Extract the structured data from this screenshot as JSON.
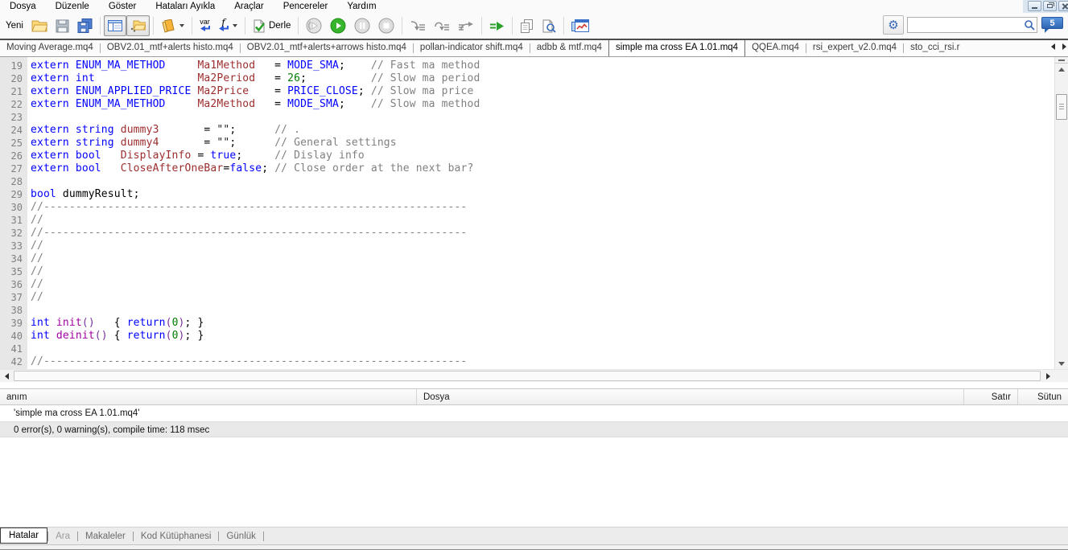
{
  "menu": {
    "items": [
      "Dosya",
      "Düzenle",
      "Göster",
      "Hataları Ayıkla",
      "Araçlar",
      "Pencereler",
      "Yardım"
    ]
  },
  "toolbar": {
    "new_label": "Yeni",
    "compile_label": "Derle",
    "var_label": "var",
    "fn_label": "f",
    "search_value": "",
    "community_label": "5"
  },
  "tabs": {
    "items": [
      {
        "label": "Moving Average.mq4",
        "active": false
      },
      {
        "label": "OBV2.01_mtf+alerts histo.mq4",
        "active": false
      },
      {
        "label": "OBV2.01_mtf+alerts+arrows histo.mq4",
        "active": false
      },
      {
        "label": "pollan-indicator shift.mq4",
        "active": false
      },
      {
        "label": "adbb & mtf.mq4",
        "active": false
      },
      {
        "label": "simple ma cross EA 1.01.mq4",
        "active": true
      },
      {
        "label": "QQEA.mq4",
        "active": false
      },
      {
        "label": "rsi_expert_v2.0.mq4",
        "active": false
      },
      {
        "label": "sto_cci_rsi.r",
        "active": false
      }
    ]
  },
  "syntax_colors": {
    "keyword": "#0000ff",
    "identifier": "#9c2d2d",
    "number": "#007d00",
    "comment": "#808080",
    "plain": "#000000",
    "function": "#a100a1",
    "bracket": "#7d30a0",
    "string": "#202020"
  },
  "editor": {
    "lines": [
      {
        "n": 19,
        "t": [
          [
            "k",
            "extern"
          ],
          [
            "p",
            " "
          ],
          [
            "k",
            "ENUM_MA_METHOD"
          ],
          [
            "p",
            "     "
          ],
          [
            "i",
            "Ma1Method"
          ],
          [
            "p",
            "   = "
          ],
          [
            "k",
            "MODE_SMA"
          ],
          [
            "p",
            ";    "
          ],
          [
            "c",
            "// Fast ma method"
          ]
        ]
      },
      {
        "n": 20,
        "t": [
          [
            "k",
            "extern"
          ],
          [
            "p",
            " "
          ],
          [
            "k",
            "int"
          ],
          [
            "p",
            "                "
          ],
          [
            "i",
            "Ma2Period"
          ],
          [
            "p",
            "   = "
          ],
          [
            "n",
            "26"
          ],
          [
            "p",
            ";          "
          ],
          [
            "c",
            "// Slow ma period"
          ]
        ]
      },
      {
        "n": 21,
        "t": [
          [
            "k",
            "extern"
          ],
          [
            "p",
            " "
          ],
          [
            "k",
            "ENUM_APPLIED_PRICE"
          ],
          [
            "p",
            " "
          ],
          [
            "i",
            "Ma2Price"
          ],
          [
            "p",
            "    = "
          ],
          [
            "k",
            "PRICE_CLOSE"
          ],
          [
            "p",
            "; "
          ],
          [
            "c",
            "// Slow ma price"
          ]
        ]
      },
      {
        "n": 22,
        "t": [
          [
            "k",
            "extern"
          ],
          [
            "p",
            " "
          ],
          [
            "k",
            "ENUM_MA_METHOD"
          ],
          [
            "p",
            "     "
          ],
          [
            "i",
            "Ma2Method"
          ],
          [
            "p",
            "   = "
          ],
          [
            "k",
            "MODE_SMA"
          ],
          [
            "p",
            ";    "
          ],
          [
            "c",
            "// Slow ma method"
          ]
        ]
      },
      {
        "n": 23,
        "t": []
      },
      {
        "n": 24,
        "t": [
          [
            "k",
            "extern"
          ],
          [
            "p",
            " "
          ],
          [
            "k",
            "string"
          ],
          [
            "p",
            " "
          ],
          [
            "i",
            "dummy3"
          ],
          [
            "p",
            "       = "
          ],
          [
            "s",
            "\"\""
          ],
          [
            "p",
            ";      "
          ],
          [
            "c",
            "// ."
          ]
        ]
      },
      {
        "n": 25,
        "t": [
          [
            "k",
            "extern"
          ],
          [
            "p",
            " "
          ],
          [
            "k",
            "string"
          ],
          [
            "p",
            " "
          ],
          [
            "i",
            "dummy4"
          ],
          [
            "p",
            "       = "
          ],
          [
            "s",
            "\"\""
          ],
          [
            "p",
            ";      "
          ],
          [
            "c",
            "// General settings"
          ]
        ]
      },
      {
        "n": 26,
        "t": [
          [
            "k",
            "extern"
          ],
          [
            "p",
            " "
          ],
          [
            "k",
            "bool"
          ],
          [
            "p",
            "   "
          ],
          [
            "i",
            "DisplayInfo"
          ],
          [
            "p",
            " = "
          ],
          [
            "k",
            "true"
          ],
          [
            "p",
            ";     "
          ],
          [
            "c",
            "// Dislay info"
          ]
        ]
      },
      {
        "n": 27,
        "t": [
          [
            "k",
            "extern"
          ],
          [
            "p",
            " "
          ],
          [
            "k",
            "bool"
          ],
          [
            "p",
            "   "
          ],
          [
            "i",
            "CloseAfterOneBar"
          ],
          [
            "p",
            "="
          ],
          [
            "k",
            "false"
          ],
          [
            "p",
            "; "
          ],
          [
            "c",
            "// Close order at the next bar?"
          ]
        ]
      },
      {
        "n": 28,
        "t": []
      },
      {
        "n": 29,
        "t": [
          [
            "k",
            "bool"
          ],
          [
            "p",
            " dummyResult;"
          ]
        ]
      },
      {
        "n": 30,
        "t": [
          [
            "c",
            "//------------------------------------------------------------------"
          ]
        ]
      },
      {
        "n": 31,
        "t": [
          [
            "c",
            "//"
          ]
        ]
      },
      {
        "n": 32,
        "t": [
          [
            "c",
            "//------------------------------------------------------------------"
          ]
        ]
      },
      {
        "n": 33,
        "t": [
          [
            "c",
            "//"
          ]
        ]
      },
      {
        "n": 34,
        "t": [
          [
            "c",
            "//"
          ]
        ]
      },
      {
        "n": 35,
        "t": [
          [
            "c",
            "//"
          ]
        ]
      },
      {
        "n": 36,
        "t": [
          [
            "c",
            "//"
          ]
        ]
      },
      {
        "n": 37,
        "t": [
          [
            "c",
            "//"
          ]
        ]
      },
      {
        "n": 38,
        "t": []
      },
      {
        "n": 39,
        "t": [
          [
            "k",
            "int"
          ],
          [
            "p",
            " "
          ],
          [
            "f",
            "init"
          ],
          [
            "v",
            "()"
          ],
          [
            "p",
            "   { "
          ],
          [
            "k",
            "return"
          ],
          [
            "v",
            "("
          ],
          [
            "n",
            "0"
          ],
          [
            "v",
            ")"
          ],
          [
            "p",
            "; }"
          ]
        ]
      },
      {
        "n": 40,
        "t": [
          [
            "k",
            "int"
          ],
          [
            "p",
            " "
          ],
          [
            "f",
            "deinit"
          ],
          [
            "v",
            "()"
          ],
          [
            "p",
            " { "
          ],
          [
            "k",
            "return"
          ],
          [
            "v",
            "("
          ],
          [
            "n",
            "0"
          ],
          [
            "v",
            ")"
          ],
          [
            "p",
            "; }"
          ]
        ]
      },
      {
        "n": 41,
        "t": []
      },
      {
        "n": 42,
        "t": [
          [
            "c",
            "//------------------------------------------------------------------"
          ]
        ]
      }
    ]
  },
  "error_panel": {
    "columns": [
      "anım",
      "Dosya",
      "Satır",
      "Sütun"
    ],
    "rows": [
      "'simple ma cross EA 1.01.mq4'",
      "0 error(s), 0 warning(s), compile time: 118 msec"
    ]
  },
  "bottom_tabs": {
    "items": [
      {
        "label": "Hatalar",
        "active": true
      },
      {
        "label": "Ara",
        "active": false,
        "muted": true
      },
      {
        "label": "Makaleler",
        "active": false
      },
      {
        "label": "Kod Kütüphanesi",
        "active": false
      },
      {
        "label": "Günlük",
        "active": false
      }
    ]
  }
}
